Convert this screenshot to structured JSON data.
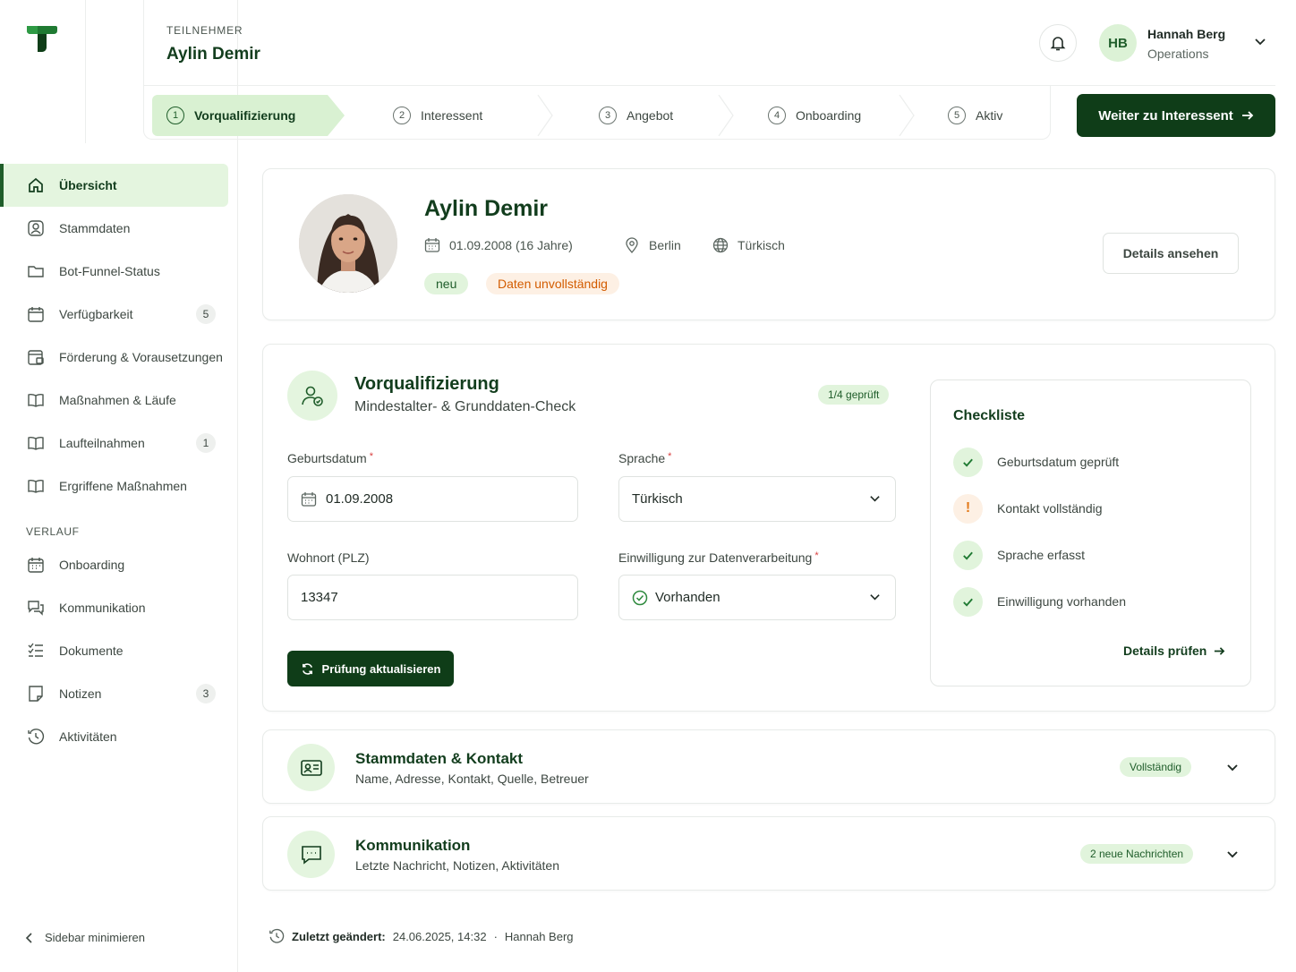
{
  "header": {
    "eyebrow": "TEILNEHMER",
    "name": "Aylin Demir",
    "user_initials": "HB",
    "user_name": "Hannah Berg",
    "user_role": "Operations"
  },
  "stepper": {
    "steps": [
      {
        "num": "1",
        "label": "Vorqualifizierung",
        "state": "active"
      },
      {
        "num": "2",
        "label": "Interessent",
        "state": "pending"
      },
      {
        "num": "3",
        "label": "Angebot",
        "state": "pending"
      },
      {
        "num": "4",
        "label": "Onboarding",
        "state": "pending"
      },
      {
        "num": "5",
        "label": "Aktiv",
        "state": "pending"
      }
    ],
    "next_button": "Weiter zu Interessent"
  },
  "sidebar": {
    "items": [
      {
        "label": "Übersicht",
        "icon": "home-icon",
        "active": true
      },
      {
        "label": "Stammdaten",
        "icon": "user-circle-icon"
      },
      {
        "label": "Bot-Funnel-Status",
        "icon": "folder-icon"
      },
      {
        "label": "Verfügbarkeit",
        "icon": "calendar-icon",
        "badge": "5"
      },
      {
        "label": "Förderung & Vorausetzungen",
        "icon": "calendar-check-icon"
      },
      {
        "label": "Maßnahmen & Läufe",
        "icon": "book-icon"
      },
      {
        "label": "Laufteilnahmen",
        "icon": "book-icon",
        "badge": "1"
      },
      {
        "label": "Ergriffene Maßnahmen",
        "icon": "book-icon"
      }
    ],
    "section_label": "VERLAUF",
    "history_items": [
      {
        "label": "Onboarding",
        "icon": "calendar-grid-icon"
      },
      {
        "label": "Kommunikation",
        "icon": "chat-icon"
      },
      {
        "label": "Dokumente",
        "icon": "checklist-icon"
      },
      {
        "label": "Notizen",
        "icon": "note-icon",
        "badge": "3"
      },
      {
        "label": "Aktivitäten",
        "icon": "history-icon"
      }
    ],
    "collapse_label": "Sidebar minimieren"
  },
  "profile": {
    "name": "Aylin Demir",
    "birthdate": "01.09.2008 (16 Jahre)",
    "city": "Berlin",
    "language": "Türkisch",
    "tag_new": "neu",
    "tag_incomplete": "Daten unvollständig",
    "details_button": "Details ansehen"
  },
  "prequal": {
    "title": "Vorqualifizierung",
    "subtitle": "Mindestalter- & Grunddaten-Check",
    "progress_badge": "1/4 geprüft",
    "fields": {
      "birthdate_label": "Geburtsdatum",
      "birthdate_value": "01.09.2008",
      "language_label": "Sprache",
      "language_value": "Türkisch",
      "zip_label": "Wohnort (PLZ)",
      "zip_value": "13347",
      "consent_label": "Einwilligung zur Datenverarbeitung",
      "consent_value": "Vorhanden",
      "required_mark": "*"
    },
    "refresh_button": "Prüfung aktualisieren",
    "checklist": {
      "title": "Checkliste",
      "items": [
        {
          "label": "Geburtsdatum geprüft",
          "status": "ok"
        },
        {
          "label": "Kontakt vollständig",
          "status": "warn",
          "mark": "!"
        },
        {
          "label": "Sprache erfasst",
          "status": "ok"
        },
        {
          "label": "Einwilligung vorhanden",
          "status": "ok"
        }
      ],
      "link": "Details prüfen"
    }
  },
  "sections": [
    {
      "title": "Stammdaten & Kontakt",
      "subtitle": "Name, Adresse, Kontakt, Quelle, Betreuer",
      "badge": "Vollständig"
    },
    {
      "title": "Kommunikation",
      "subtitle": "Letzte Nachricht, Notizen, Aktivitäten",
      "badge": "2 neue Nachrichten"
    }
  ],
  "footer": {
    "label": "Zuletzt geändert:",
    "timestamp": "24.06.2025, 14:32",
    "separator": "·",
    "user": "Hannah Berg"
  },
  "colors": {
    "brand_dark": "#0f3d18",
    "brand_light": "#e4f5df",
    "warning": "#d35c00"
  }
}
